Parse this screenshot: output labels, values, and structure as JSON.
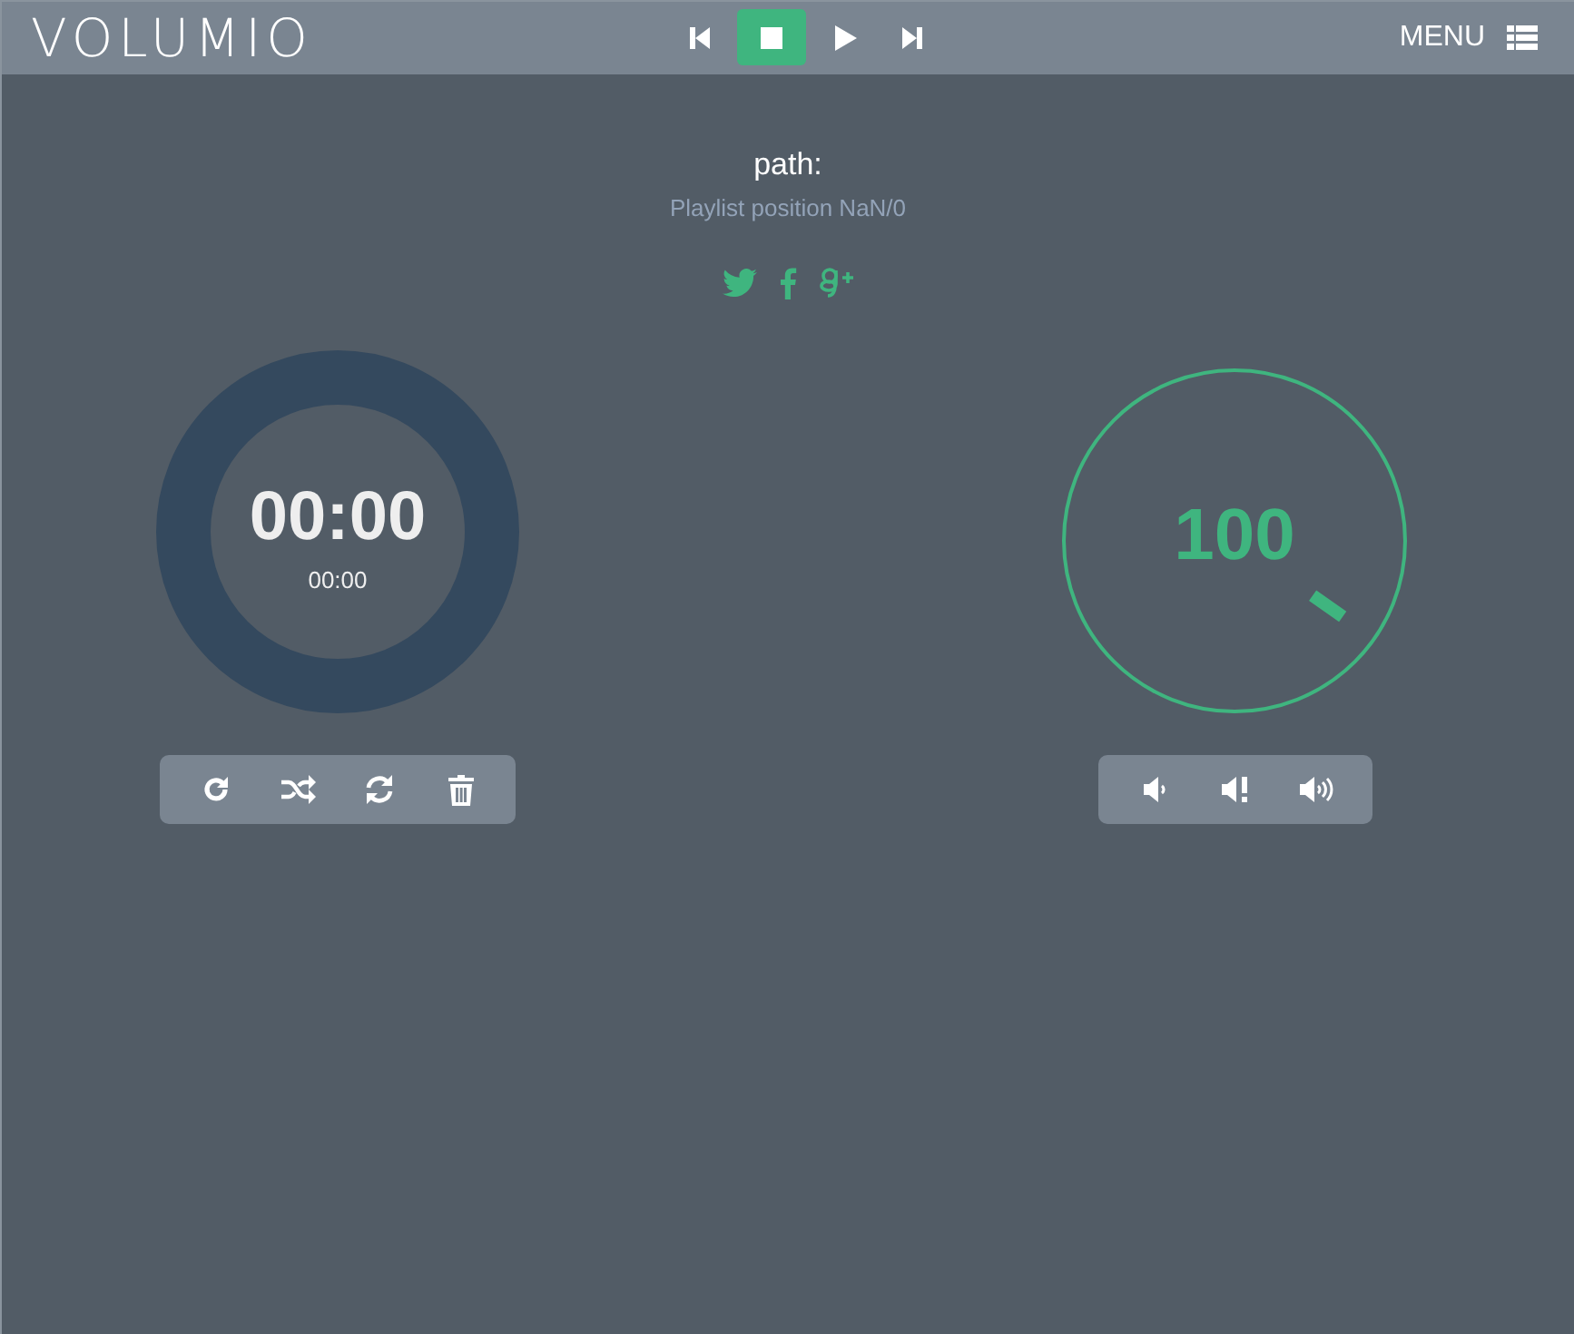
{
  "header": {
    "logo": "VOLUMIO",
    "transport": [
      {
        "kind": "previous",
        "selected": false
      },
      {
        "kind": "stop",
        "selected": true
      },
      {
        "kind": "play",
        "selected": false
      },
      {
        "kind": "next",
        "selected": false
      }
    ],
    "menu": "MENU"
  },
  "track": {
    "title": "path:",
    "position": "Playlist position NaN/0"
  },
  "share": [
    {
      "kind": "twitter"
    },
    {
      "kind": "facebook"
    },
    {
      "kind": "googleplus"
    }
  ],
  "time": {
    "elapsed": "00:00",
    "total": "00:00",
    "level": 0
  },
  "playback_controls": [
    {
      "kind": "repeat"
    },
    {
      "kind": "shuffle"
    },
    {
      "kind": "refresh"
    },
    {
      "kind": "delete"
    }
  ],
  "volume": {
    "value": "100"
  },
  "volume_controls": [
    {
      "kind": "volume-down"
    },
    {
      "kind": "mute"
    },
    {
      "kind": "volume-up"
    }
  ]
}
